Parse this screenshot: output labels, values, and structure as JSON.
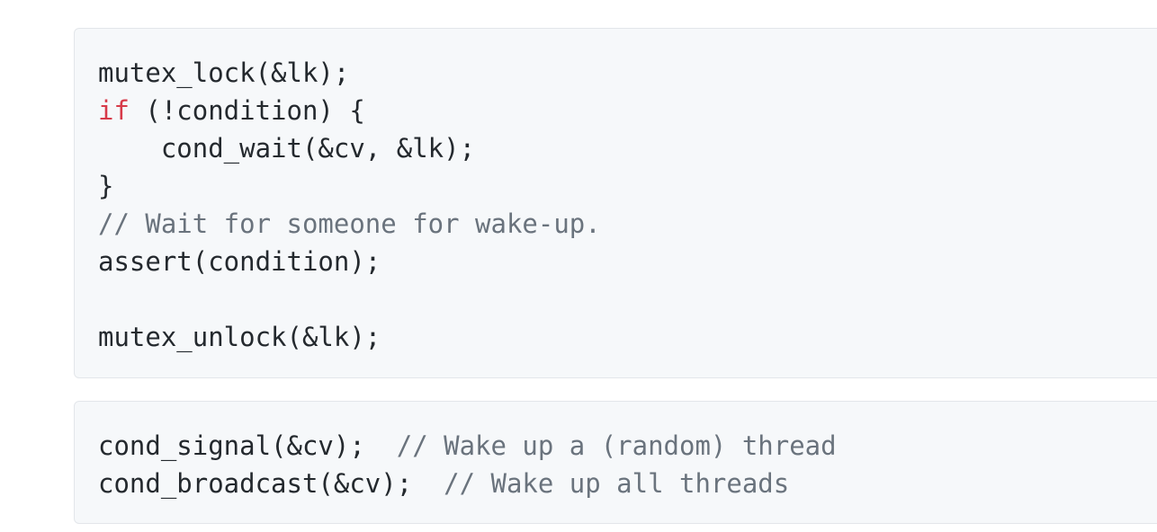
{
  "snippets": [
    {
      "lines": [
        [
          {
            "t": "plain",
            "v": "mutex_lock(&lk);"
          }
        ],
        [
          {
            "t": "kw",
            "v": "if"
          },
          {
            "t": "plain",
            "v": " (!condition) {"
          }
        ],
        [
          {
            "t": "plain",
            "v": "    cond_wait(&cv, &lk);"
          }
        ],
        [
          {
            "t": "plain",
            "v": "}"
          }
        ],
        [
          {
            "t": "cmt",
            "v": "// Wait for someone for wake-up."
          }
        ],
        [
          {
            "t": "plain",
            "v": "assert(condition);"
          }
        ],
        [],
        [
          {
            "t": "plain",
            "v": "mutex_unlock(&lk);"
          }
        ]
      ]
    },
    {
      "lines": [
        [
          {
            "t": "plain",
            "v": "cond_signal(&cv);  "
          },
          {
            "t": "cmt",
            "v": "// Wake up a (random) thread"
          }
        ],
        [
          {
            "t": "plain",
            "v": "cond_broadcast(&cv);  "
          },
          {
            "t": "cmt",
            "v": "// Wake up all threads"
          }
        ]
      ]
    }
  ],
  "colors": {
    "keyword": "#d73a49",
    "comment": "#6a737d",
    "text": "#24292e",
    "background": "#f6f8fa"
  }
}
